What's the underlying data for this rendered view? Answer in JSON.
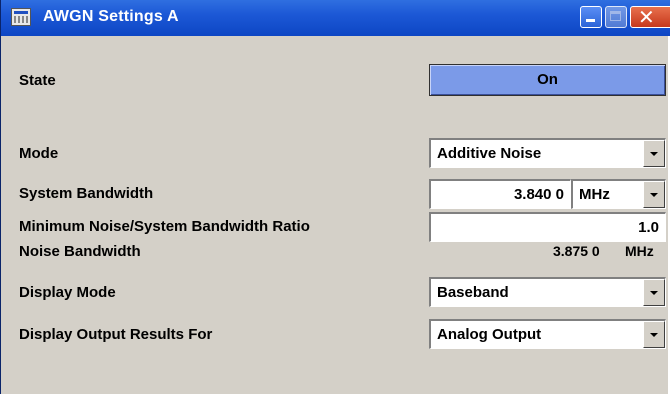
{
  "window": {
    "title": "AWGN Settings A",
    "icon": "settings-window-icon",
    "controls": {
      "minimize": "minimize-icon",
      "maximize": "maximize-icon",
      "close": "close-icon"
    }
  },
  "colors": {
    "titlebar": "#1c58d6",
    "panel": "#d4d0c8",
    "on_button": "#7b9ae8",
    "close_button": "#c6381c"
  },
  "form": {
    "state": {
      "label": "State",
      "value": "On"
    },
    "mode": {
      "label": "Mode",
      "value": "Additive Noise"
    },
    "system_bandwidth": {
      "label": "System Bandwidth",
      "value": "3.840 0",
      "unit": "MHz"
    },
    "min_ratio": {
      "label": "Minimum Noise/System Bandwidth Ratio",
      "value": "1.0"
    },
    "noise_bandwidth": {
      "label": "Noise Bandwidth",
      "value": "3.875 0",
      "unit": "MHz"
    },
    "display_mode": {
      "label": "Display Mode",
      "value": "Baseband"
    },
    "display_output": {
      "label": "Display Output Results For",
      "value": "Analog Output"
    }
  }
}
